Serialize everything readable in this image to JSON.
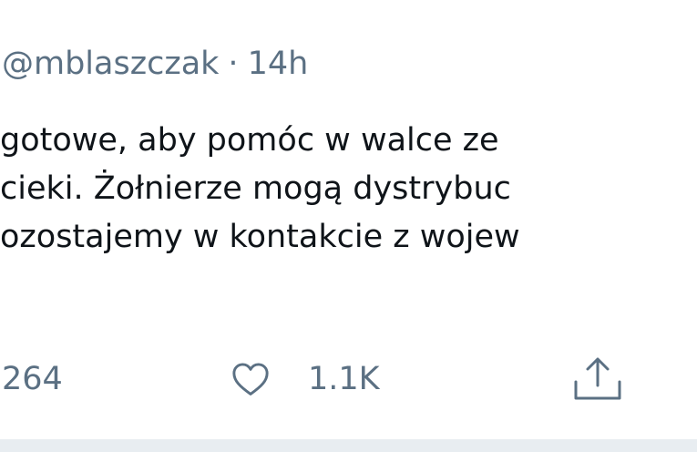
{
  "header": {
    "handle": "@mblaszczak",
    "separator": "·",
    "time": "14h"
  },
  "body": {
    "lines": [
      "gotowe, aby pomóc w walce ze",
      "cieki. Żołnierze mogą dystrybuc",
      "ozostajemy w kontakcie z wojew"
    ]
  },
  "actions": {
    "replies_count": "264",
    "likes_count": "1.1K"
  },
  "icons": {
    "like": "heart-icon",
    "share": "share-icon"
  },
  "colors": {
    "text": "#0f1419",
    "secondary": "#5b7083",
    "divider": "#e8edf1"
  }
}
